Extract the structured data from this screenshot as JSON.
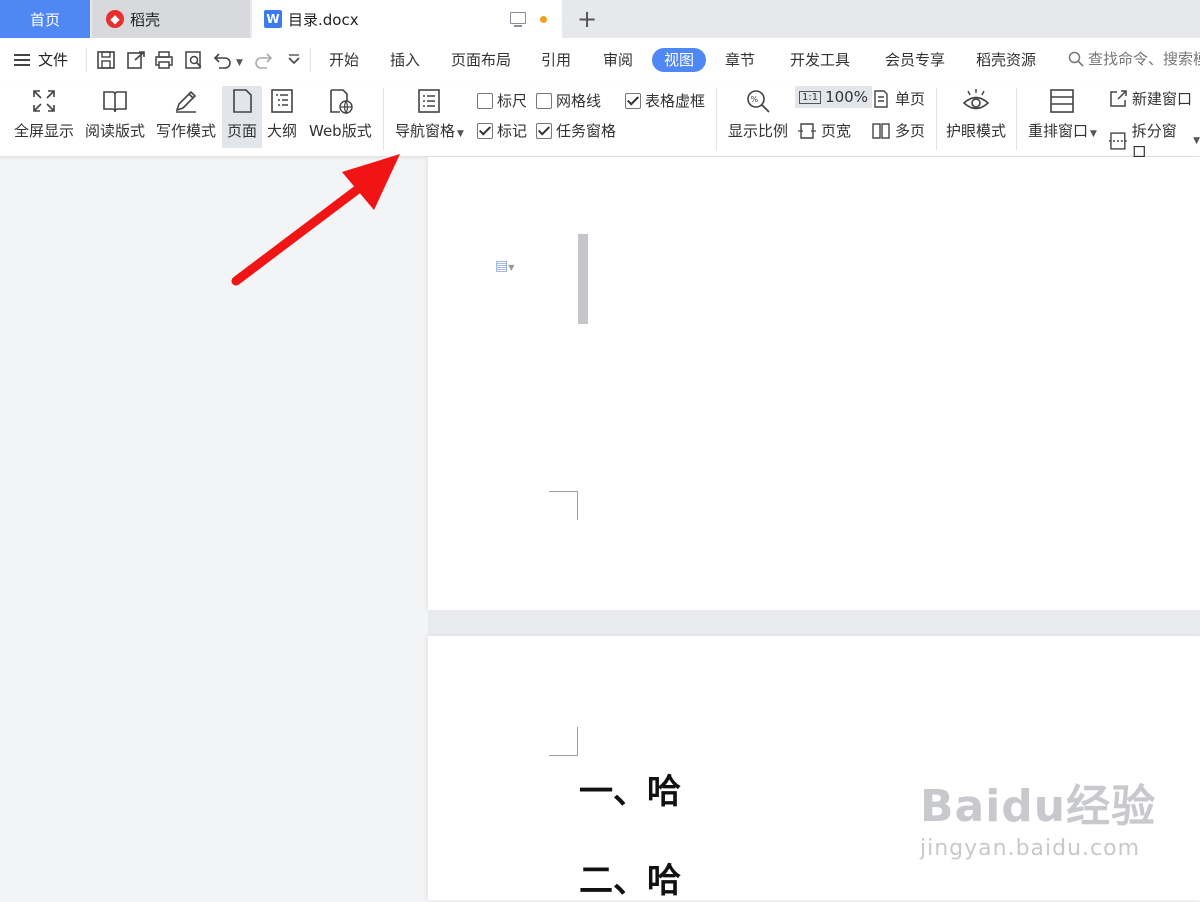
{
  "tabs": {
    "home": "首页",
    "daoke": "稻壳",
    "doc": "目录.docx",
    "doc_icon_letter": "W"
  },
  "menu": {
    "file": "文件",
    "items": [
      "开始",
      "插入",
      "页面布局",
      "引用",
      "审阅",
      "视图",
      "章节",
      "开发工具",
      "会员专享",
      "稻壳资源"
    ],
    "active": "视图",
    "search": "查找命令、搜索模"
  },
  "ribbon": {
    "fullscreen": "全屏显示",
    "reading": "阅读版式",
    "writing": "写作模式",
    "page": "页面",
    "outline": "大纲",
    "web": "Web版式",
    "nav_pane": "导航窗格",
    "ruler": "标尺",
    "gridlines": "网格线",
    "table_frame": "表格虚框",
    "marks": "标记",
    "task_pane": "任务窗格",
    "zoom": "显示比例",
    "zoom_100": "100%",
    "zoom_100_icon": "1:1",
    "single_page": "单页",
    "page_width": "页宽",
    "multi_page": "多页",
    "eye_care": "护眼模式",
    "arrange": "重排窗口",
    "new_window": "新建窗口",
    "split": "拆分窗口"
  },
  "checks": {
    "ruler": false,
    "gridlines": false,
    "table_frame": true,
    "marks": true,
    "task_pane": true
  },
  "document": {
    "heading1": "一、哈",
    "heading2": "二、哈"
  },
  "watermark": {
    "main": "Baidu经验",
    "sub": "jingyan.baidu.com"
  },
  "colors": {
    "accent": "#4f87f5",
    "arrow": "#f01414"
  }
}
